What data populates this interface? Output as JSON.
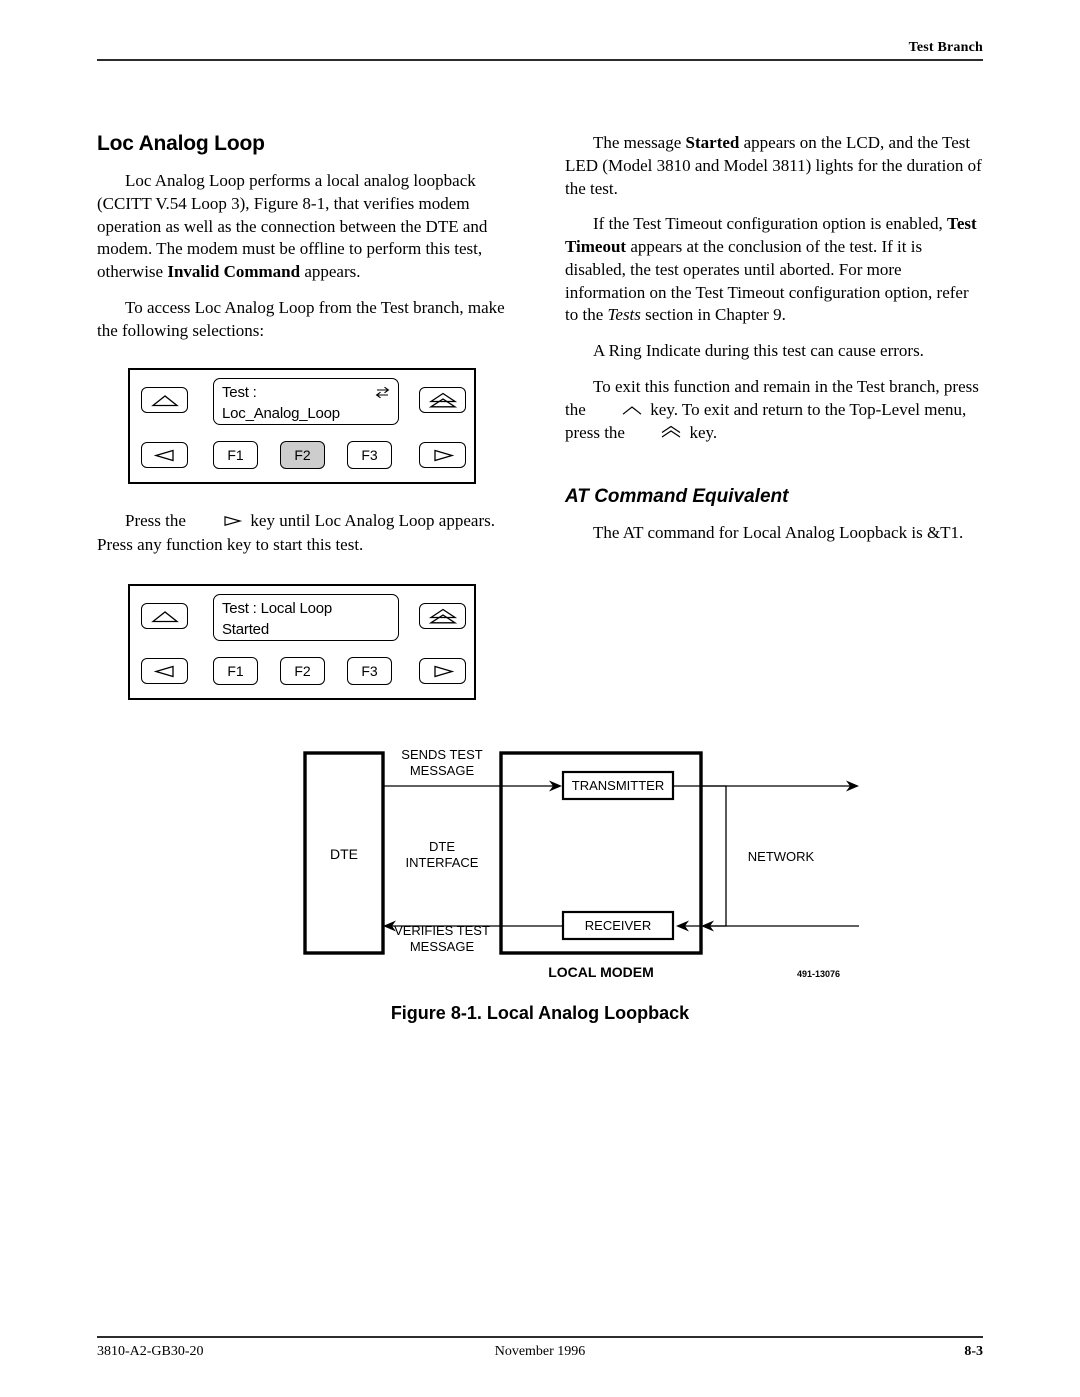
{
  "header": {
    "running_head": "Test Branch"
  },
  "left_column": {
    "title": "Loc Analog Loop",
    "paragraph_1": {
      "part_a": "Loc Analog Loop performs a local analog loopback (CCITT V.54 Loop 3), Figure 8-1, that verifies modem operation as well as the connection between the DTE and modem. The modem must be offline to perform this test, otherwise ",
      "bold": "Invalid Command",
      "part_b": " appears."
    },
    "paragraph_2": "To access Loc Analog Loop from the Test branch, make the following selections:",
    "paragraph_3": {
      "part_a": "Press the ",
      "key_icon": "right-arrow-key",
      "part_b": " key until Loc Analog Loop appears. Press any function key to start this test."
    }
  },
  "right_column": {
    "paragraph_1": {
      "part_a": "The message ",
      "bold": "Started",
      "part_b": " appears on the LCD, and the Test LED (Model 3810 and Model 3811) lights for the duration of the test."
    },
    "paragraph_2": {
      "part_a": "If the Test Timeout configuration option is enabled, ",
      "bold": "Test Timeout",
      "part_b": " appears at the conclusion of the test. If it is disabled, the test operates until aborted. For more information on the Test Timeout configuration option, refer to the ",
      "italic": "Tests",
      "part_c": " section in Chapter 9."
    },
    "paragraph_3": "A Ring Indicate during this test can cause errors.",
    "paragraph_4": {
      "part_a": "To exit this function and remain in the Test branch, press the ",
      "key_icon_1": "up-triangle-key",
      "part_b": " key. To exit and return to the Top-Level menu, press the ",
      "key_icon_2": "double-triangle-key",
      "part_c": " key."
    },
    "subheading": "AT Command Equivalent",
    "paragraph_5": "The AT command for Local Analog Loopback is &T1."
  },
  "keypad_1": {
    "lcd_line_1": "Test :",
    "lcd_line_2": "Loc_Analog_Loop",
    "lcd_icon": "double-arrow-icon",
    "up_key": "up-triangle-key",
    "left_key": "left-triangle-key",
    "top_level_key": "double-triangle-key",
    "right_key": "right-triangle-key",
    "f1": "F1",
    "f2": "F2",
    "f3": "F3",
    "highlighted_key": "F2",
    "highlight_color": "#cdcdcd"
  },
  "keypad_2": {
    "lcd_line_1": "Test : Local Loop",
    "lcd_line_2": "Started",
    "lcd_icon": "",
    "up_key": "up-triangle-key",
    "left_key": "left-triangle-key",
    "top_level_key": "double-triangle-key",
    "right_key": "right-triangle-key",
    "f1": "F1",
    "f2": "F2",
    "f3": "F3",
    "highlighted_key": "",
    "highlight_color": "#cdcdcd"
  },
  "figure": {
    "caption": "Figure 8-1.  Local Analog Loopback",
    "dte_label": "DTE",
    "sends_label_line1": "SENDS TEST",
    "sends_label_line2": "MESSAGE",
    "interface_label_line1": "DTE",
    "interface_label_line2": "INTERFACE",
    "verifies_label_line1": "VERIFIES TEST",
    "verifies_label_line2": "MESSAGE",
    "transmitter_label": "TRANSMITTER",
    "receiver_label": "RECEIVER",
    "network_label": "NETWORK",
    "modem_label": "LOCAL MODEM",
    "part_number": "491-13076"
  },
  "footer": {
    "document_number": "3810-A2-GB30-20",
    "date": "November 1996",
    "page_number": "8-3"
  }
}
